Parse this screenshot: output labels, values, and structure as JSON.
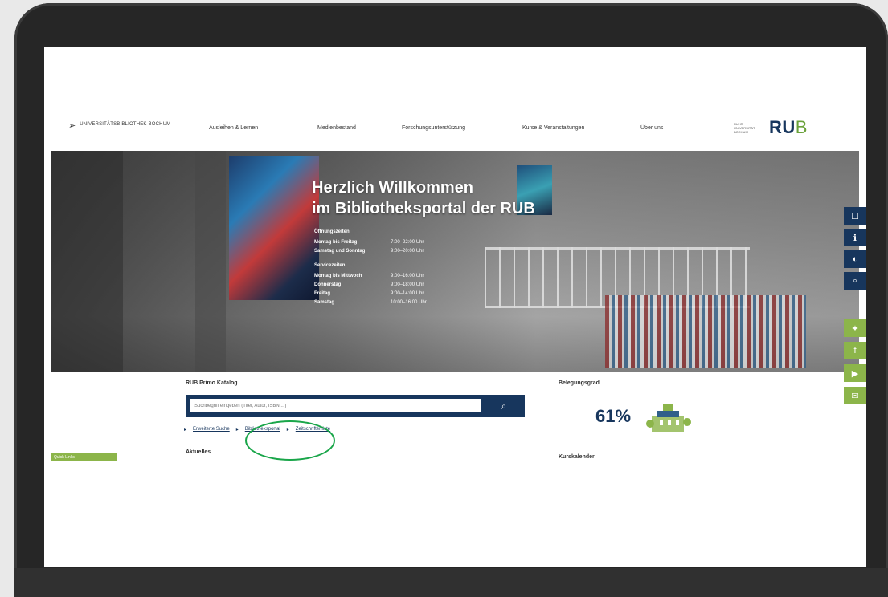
{
  "header": {
    "logo_left": "UNIVERSITÄTSBIBLIOTHEK BOCHUM",
    "logo_small": "RUHR UNIVERSITÄT BOCHUM",
    "logo_rub": "RU",
    "logo_rub_b": "B",
    "nav": [
      {
        "label": "Ausleihen & Lernen"
      },
      {
        "label": "Medienbestand"
      },
      {
        "label": "Forschungsunterstützung"
      },
      {
        "label": "Kurse & Veranstaltungen"
      },
      {
        "label": "Über uns"
      }
    ]
  },
  "hero": {
    "title_line1": "Herzlich Willkommen",
    "title_line2": "im Bibliotheksportal der RUB",
    "opening": {
      "title": "Öffnungszeiten",
      "rows": [
        {
          "k": "Montag bis Freitag",
          "v": "7:00–22:00 Uhr"
        },
        {
          "k": "Samstag und Sonntag",
          "v": "9:00–20:00 Uhr"
        }
      ]
    },
    "service": {
      "title": "Servicezeiten",
      "rows": [
        {
          "k": "Montag bis Mittwoch",
          "v": "9:00–16:00 Uhr"
        },
        {
          "k": "Donnerstag",
          "v": "9:00–18:00 Uhr"
        },
        {
          "k": "Freitag",
          "v": "9:00–14:00 Uhr"
        },
        {
          "k": "Samstag",
          "v": "10:00–16:00 Uhr"
        }
      ]
    }
  },
  "search": {
    "label": "RUB Primo Katalog",
    "placeholder": "Suchbegriff eingeben (Titel, Autor, ISBN ...)",
    "links": [
      "Erweiterte Suche",
      "Bibliotheksportal",
      "Zeitschriftenliste"
    ]
  },
  "occupancy": {
    "label": "Belegungsgrad",
    "value": "61%"
  },
  "lower": {
    "news": "Aktuelles",
    "calendar": "Kurskalender",
    "green_tab": "Quick Links"
  },
  "colors": {
    "primary": "#17365d",
    "green": "#8cb54a",
    "highlight": "#1aa64a"
  }
}
